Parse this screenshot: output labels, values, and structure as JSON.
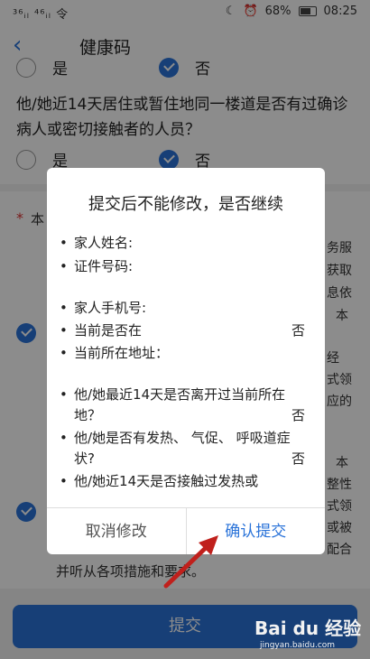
{
  "status_bar": {
    "left": "³⁶ᵢₗ ⁴⁶ᵢₗ 令",
    "moon": "☾",
    "alarm": "⏰",
    "battery": "68%",
    "time": "08:25"
  },
  "nav": {
    "title": "健康码"
  },
  "form": {
    "prev_yes": "是",
    "prev_no": "否",
    "question": "他/她近14天居住或暂住地同一楼道是否有过确诊病人或密切接触者的人员？",
    "yes": "是",
    "no": "否",
    "star": "*",
    "star_text": "本",
    "side_texts": [
      "务服",
      "获取",
      "息依",
      "本",
      "经",
      "式领",
      "应的",
      "本",
      "整性",
      "式领",
      "或被",
      "配合"
    ],
    "bottom_line": "并听从各项措施和要求。",
    "submit": "提交"
  },
  "dialog": {
    "title": "提交后不能修改，是否继续",
    "bullet": "•",
    "items": [
      {
        "text": "家人姓名:",
        "value": ""
      },
      {
        "text": "证件号码:",
        "value": ""
      },
      {
        "text": "家人手机号:",
        "value": ""
      },
      {
        "text": "当前是否在",
        "value": "否"
      },
      {
        "text": "当前所在地址：",
        "value": ""
      },
      {
        "text": "他/她最近14天是否离开过当前所在地？",
        "value": "否"
      },
      {
        "text": "他/她是否有发热、 气促、 呼吸道症状?",
        "value": "否"
      },
      {
        "text": "他/她近14天是否接触过发热或",
        "value": ""
      }
    ],
    "cancel": "取消修改",
    "confirm": "确认提交"
  },
  "watermark": {
    "logo": "Bai du 经验",
    "url": "jingyan.baidu.com"
  },
  "colors": {
    "accent": "#2a73d9",
    "arrow": "#c0201c"
  }
}
